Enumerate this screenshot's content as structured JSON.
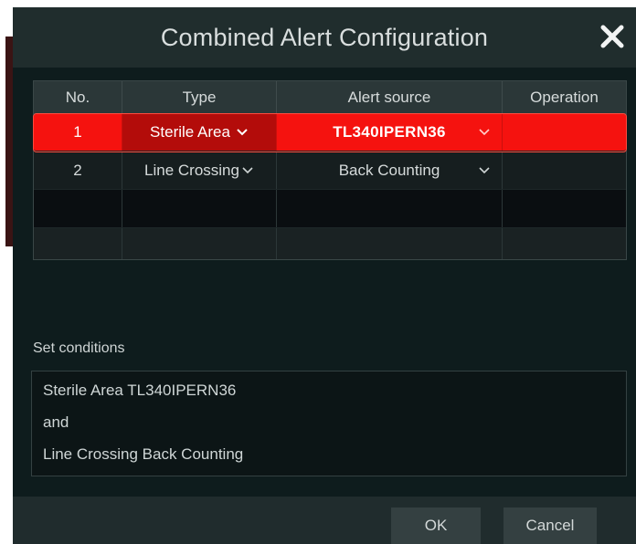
{
  "dialog": {
    "title": "Combined Alert Configuration",
    "close_icon": "close-icon"
  },
  "table": {
    "headers": [
      "No.",
      "Type",
      "Alert source",
      "Operation"
    ],
    "rows": [
      {
        "no": "1",
        "type": "Sterile Area",
        "source": "TL340IPERN36",
        "operation": "",
        "selected": true
      },
      {
        "no": "2",
        "type": "Line Crossing",
        "source": "Back Counting",
        "operation": "",
        "selected": false
      }
    ]
  },
  "conditions": {
    "label": "Set conditions",
    "lines": [
      "Sterile Area TL340IPERN36",
      "and",
      "Line Crossing Back Counting"
    ]
  },
  "footer": {
    "ok_label": "OK",
    "cancel_label": "Cancel"
  },
  "colors": {
    "selected_row": "#f5120f",
    "background": "#0e1c1d",
    "titlebar": "#202d2d"
  }
}
